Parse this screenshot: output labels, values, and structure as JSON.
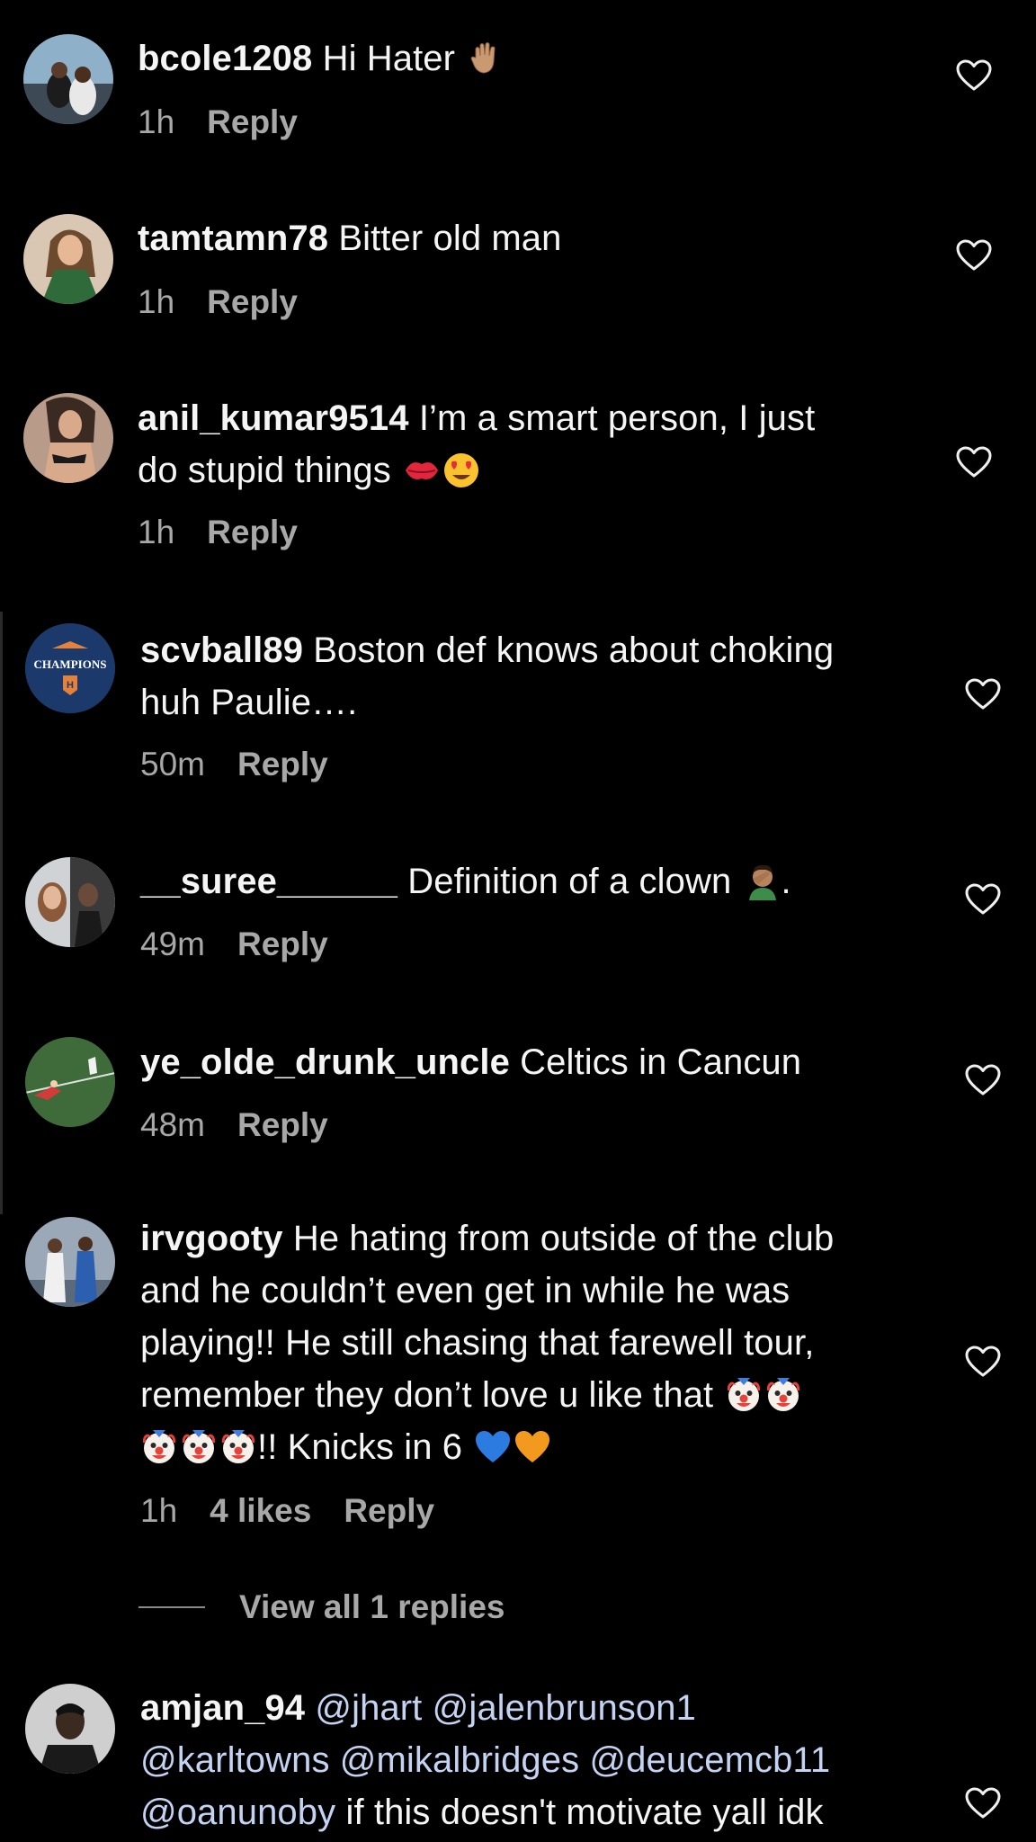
{
  "comments": [
    {
      "user": "bcole1208",
      "text": "Hi Hater",
      "time": "1h",
      "reply": "Reply"
    },
    {
      "user": "tamtamn78",
      "text": "Bitter old man",
      "time": "1h",
      "reply": "Reply"
    },
    {
      "user": "anil_kumar9514",
      "text": "I’m a smart person, I just",
      "text2": "do stupid things",
      "time": "1h",
      "reply": "Reply"
    },
    {
      "user": "scvball89",
      "text": "Boston def knows about choking",
      "text2": "huh Paulie….",
      "time": "50m",
      "reply": "Reply",
      "avatar_text": "CHAMPIONS"
    },
    {
      "user": "__suree______",
      "text": "Definition of a clown",
      "text_after": ".",
      "time": "49m",
      "reply": "Reply"
    },
    {
      "user": "ye_olde_drunk_uncle",
      "text": "Celtics in Cancun",
      "time": "48m",
      "reply": "Reply"
    },
    {
      "user": "irvgooty",
      "text": "He hating from outside of the club",
      "line2": "and he couldn’t even get in while he was",
      "line3": "playing!! He still chasing that farewell tour,",
      "line4": "remember they don’t love u like that",
      "line5": "!! Knicks in 6",
      "time": "1h",
      "likes": "4 likes",
      "reply": "Reply"
    },
    {
      "user": "amjan_94",
      "mention1": "@jhart",
      "mention2": "@jalenbrunson1",
      "mention3": "@karltowns",
      "mention4": "@mikalbridges",
      "mention5": "@deucemcb11",
      "mention6": "@oanunoby",
      "text": "if this doesn't motivate yall idk"
    }
  ],
  "view_replies": "View all 1 replies",
  "icons": {
    "heart": "heart-outline-icon",
    "wave": "waving-hand-emoji",
    "kiss": "kiss-mark-emoji",
    "heart_eyes": "heart-eyes-emoji",
    "facepalm": "facepalm-emoji",
    "clown": "clown-face-emoji",
    "blue_heart": "blue-heart-emoji",
    "orange_heart": "orange-heart-emoji"
  },
  "colors": {
    "background": "#000000",
    "text": "#f5f5f5",
    "meta": "#a8a8a8",
    "mention": "#c4d3f2"
  }
}
